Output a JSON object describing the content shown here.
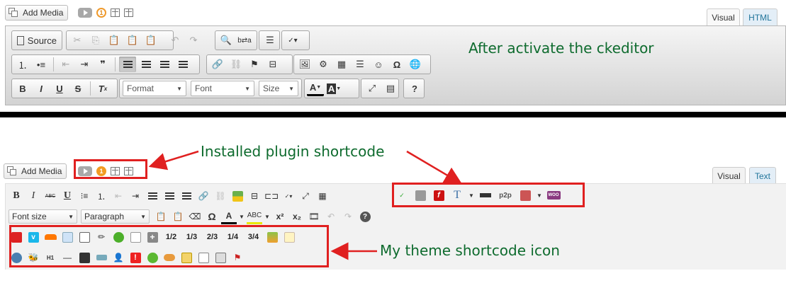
{
  "top": {
    "add_media_label": "Add Media",
    "count_badge": "1",
    "tabs": [
      "Visual",
      "HTML"
    ],
    "toolbar": {
      "source_label": "Source",
      "format_label": "Format",
      "font_label": "Font",
      "size_label": "Size",
      "help_label": "?",
      "bold": "B",
      "italic": "I",
      "underline": "U",
      "strike": "S",
      "blockquote": "❞",
      "omega": "Ω"
    },
    "annotation": "After activate the ckeditor"
  },
  "bottom": {
    "add_media_label": "Add Media",
    "count_badge": "1",
    "tabs": [
      "Visual",
      "Text"
    ],
    "toolbar": {
      "font_size_label": "Font size",
      "paragraph_label": "Paragraph",
      "fractions": [
        "1/2",
        "1/3",
        "2/3",
        "1/4",
        "3/4"
      ],
      "heading_label": "H1",
      "p2p_label": "p2p",
      "woo_label": "WOO",
      "abc_label": "ABC",
      "bold": "B",
      "italic": "I",
      "underline": "U",
      "omega": "Ω",
      "text_color": "A",
      "sup": "x²",
      "sub": "x₂",
      "t_glyph": "T"
    },
    "annotations": {
      "plugin_shortcode": "Installed plugin shortcode",
      "theme_shortcode": "My theme shortcode icon"
    }
  },
  "colors": {
    "annotation_text": "#0e6b2e",
    "annotation_red": "#e02020",
    "active_tab": "#e3eef7",
    "orange_badge": "#f29b22"
  }
}
